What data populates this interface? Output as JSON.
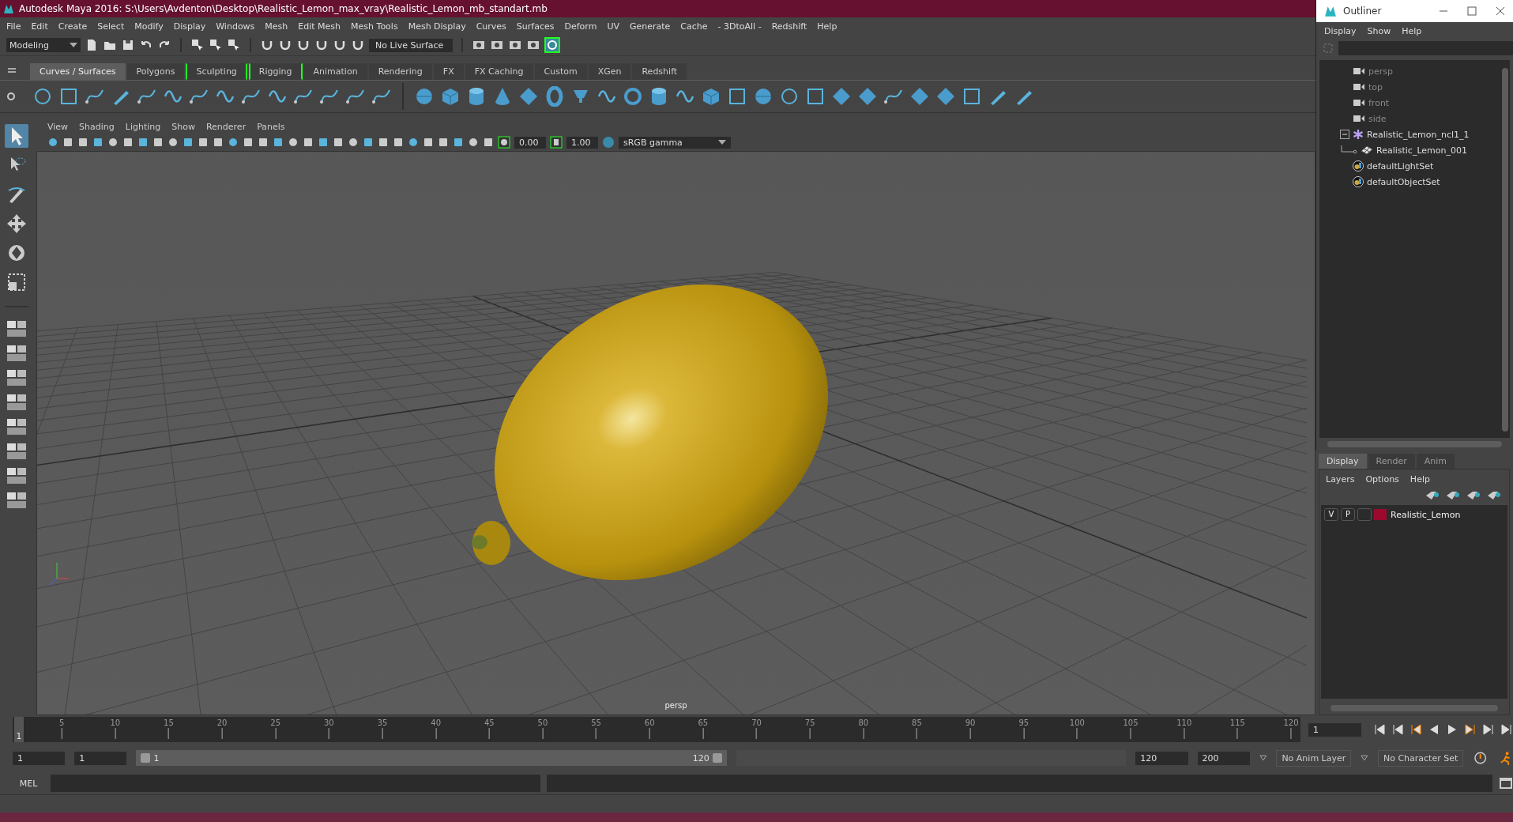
{
  "window": {
    "title": "Autodesk Maya 2016: S:\\Users\\Avdenton\\Desktop\\Realistic_Lemon_max_vray\\Realistic_Lemon_mb_standart.mb"
  },
  "menu_bar": [
    "File",
    "Edit",
    "Create",
    "Select",
    "Modify",
    "Display",
    "Windows",
    "Mesh",
    "Edit Mesh",
    "Mesh Tools",
    "Mesh Display",
    "Curves",
    "Surfaces",
    "Deform",
    "UV",
    "Generate",
    "Cache",
    "- 3DtoAll -",
    "Redshift",
    "Help"
  ],
  "status_line": {
    "mode": "Modeling",
    "live_surface": "No Live Surface"
  },
  "shelf": {
    "tabs": [
      {
        "label": "Curves / Surfaces",
        "selected": true,
        "bracketed": false
      },
      {
        "label": "Polygons",
        "selected": false,
        "bracketed": false
      },
      {
        "label": "Sculpting",
        "selected": false,
        "bracketed": true
      },
      {
        "label": "Rigging",
        "selected": false,
        "bracketed": true
      },
      {
        "label": "Animation",
        "selected": false,
        "bracketed": false
      },
      {
        "label": "Rendering",
        "selected": false,
        "bracketed": false
      },
      {
        "label": "FX",
        "selected": false,
        "bracketed": false
      },
      {
        "label": "FX Caching",
        "selected": false,
        "bracketed": false
      },
      {
        "label": "Custom",
        "selected": false,
        "bracketed": false
      },
      {
        "label": "XGen",
        "selected": false,
        "bracketed": false
      },
      {
        "label": "Redshift",
        "selected": false,
        "bracketed": false
      }
    ]
  },
  "viewport": {
    "menus": [
      "View",
      "Shading",
      "Lighting",
      "Show",
      "Renderer",
      "Panels"
    ],
    "exposure": "0.00",
    "gamma": "1.00",
    "color_space": "sRGB gamma",
    "camera_label": "persp"
  },
  "outliner": {
    "title": "Outliner",
    "menus": [
      "Display",
      "Show",
      "Help"
    ],
    "items": [
      {
        "kind": "camera",
        "label": "persp",
        "hidden": true
      },
      {
        "kind": "camera",
        "label": "top",
        "hidden": true
      },
      {
        "kind": "camera",
        "label": "front",
        "hidden": true
      },
      {
        "kind": "camera",
        "label": "side",
        "hidden": true
      },
      {
        "kind": "group",
        "label": "Realistic_Lemon_ncl1_1",
        "hidden": false,
        "expanded": true,
        "children": [
          {
            "kind": "mesh",
            "label": "Realistic_Lemon_001",
            "hidden": false
          }
        ]
      },
      {
        "kind": "set",
        "label": "defaultLightSet",
        "hidden": false
      },
      {
        "kind": "set",
        "label": "defaultObjectSet",
        "hidden": false
      }
    ]
  },
  "layer_editor": {
    "tabs": [
      {
        "label": "Display",
        "selected": true
      },
      {
        "label": "Render",
        "selected": false
      },
      {
        "label": "Anim",
        "selected": false
      }
    ],
    "menus": [
      "Layers",
      "Options",
      "Help"
    ],
    "layers": [
      {
        "visible": "V",
        "playback": "P",
        "name": "Realistic_Lemon",
        "color": "#9b0a2c"
      }
    ]
  },
  "timeline": {
    "ticks": [
      "5",
      "10",
      "15",
      "20",
      "25",
      "30",
      "35",
      "40",
      "45",
      "50",
      "55",
      "60",
      "65",
      "70",
      "75",
      "80",
      "85",
      "90",
      "95",
      "100",
      "105",
      "110",
      "115",
      "120"
    ],
    "current_frame": "1",
    "level": 0,
    "frame_field": "1"
  },
  "range": {
    "start": "1",
    "playback_start": "1",
    "slider_start": "1",
    "slider_end": "120",
    "level": 1,
    "playback_end": "120",
    "end": "200",
    "anim_layer": "No Anim Layer",
    "character_set": "No Character Set"
  },
  "command_line": {
    "label": "MEL"
  }
}
